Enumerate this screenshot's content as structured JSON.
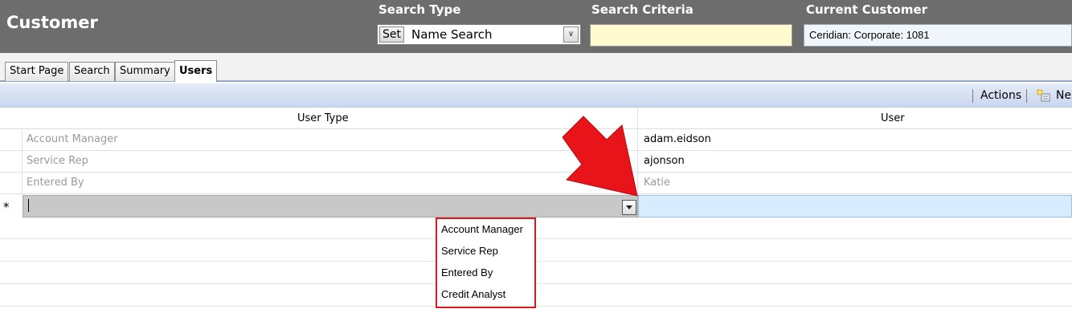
{
  "header": {
    "title": "Customer",
    "search_type_label": "Search Type",
    "search_criteria_label": "Search Criteria",
    "current_customer_label": "Current Customer",
    "set_button": "Set",
    "search_type_value": "Name Search",
    "search_criteria_value": "",
    "current_customer_value": "Ceridian: Corporate: 1081"
  },
  "tabs": [
    {
      "label": "Start Page",
      "active": false
    },
    {
      "label": "Search",
      "active": false
    },
    {
      "label": "Summary",
      "active": false
    },
    {
      "label": "Users",
      "active": true
    }
  ],
  "toolbar": {
    "actions_label": "Actions",
    "new_label": "Ne"
  },
  "grid": {
    "columns": [
      "User Type",
      "User"
    ],
    "rows": [
      {
        "user_type": "Account Manager",
        "user": "adam.eidson"
      },
      {
        "user_type": "Service Rep",
        "user": "ajonson"
      },
      {
        "user_type": "Entered By",
        "user": "Katie"
      }
    ],
    "new_row_marker": "*"
  },
  "dropdown": {
    "options": [
      "Account Manager",
      "Service Rep",
      "Entered By",
      "Credit Analyst"
    ],
    "highlight_color": "#e0181e"
  },
  "colors": {
    "header_bg": "#6d6d6d",
    "toolbar_bg": "#c9d6ee",
    "criteria_bg": "#fffbcf",
    "annotation_arrow": "#e8141a"
  }
}
